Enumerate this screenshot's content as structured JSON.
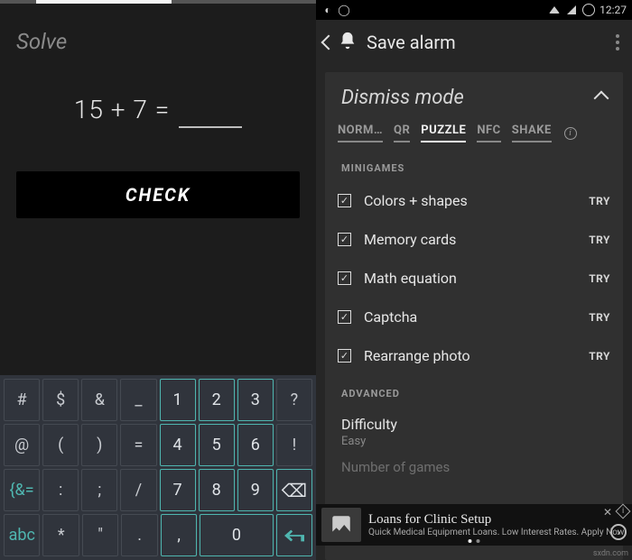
{
  "left": {
    "prompt": "Solve",
    "equation": "15 + 7 =",
    "input_value": "",
    "check_label": "CHECK",
    "keyboard": {
      "row1": [
        "#",
        "$",
        "&",
        "_",
        "1",
        "2",
        "3",
        "?"
      ],
      "row2": [
        "@",
        "(",
        ")",
        "=",
        "4",
        "5",
        "6",
        "!"
      ],
      "row3": [
        "{&=",
        ":",
        ";",
        "/",
        "7",
        "8",
        "9",
        "⌫"
      ],
      "row4": [
        "abc",
        "*",
        "\"",
        ".",
        ",",
        "0",
        "↵"
      ],
      "numeric_cols": [
        4,
        5,
        6
      ]
    }
  },
  "right": {
    "status": {
      "time": "12:27"
    },
    "appbar_title": "Save alarm",
    "section_title": "Dismiss mode",
    "tabs": [
      "NORM…",
      "QR",
      "PUZZLE",
      "NFC",
      "SHAKE"
    ],
    "active_tab": "PUZZLE",
    "minigames_header": "MINIGAMES",
    "options": [
      {
        "label": "Colors + shapes",
        "checked": true,
        "action": "TRY"
      },
      {
        "label": "Memory cards",
        "checked": true,
        "action": "TRY"
      },
      {
        "label": "Math equation",
        "checked": true,
        "action": "TRY"
      },
      {
        "label": "Captcha",
        "checked": true,
        "action": "TRY"
      },
      {
        "label": "Rearrange photo",
        "checked": true,
        "action": "TRY"
      }
    ],
    "advanced_header": "ADVANCED",
    "difficulty": {
      "title": "Difficulty",
      "value": "Easy"
    },
    "num_games_label": "Number of games"
  },
  "ad": {
    "title": "Loans for Clinic Setup",
    "subtitle": "Quick Medical Equipment Loans. Low Interest Rates. Apply Now!"
  },
  "watermark": "sxdn.com"
}
